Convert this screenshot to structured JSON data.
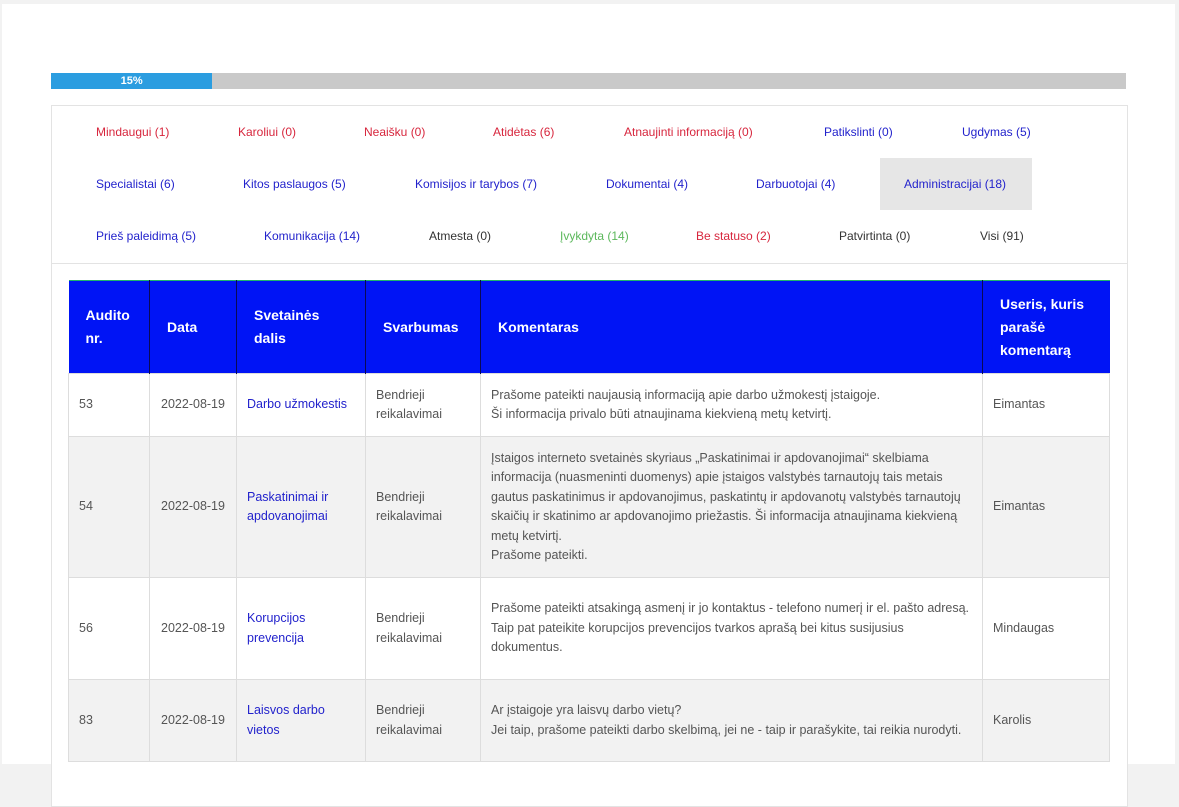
{
  "progress": {
    "label": "15%",
    "value": 0.15
  },
  "filters": [
    {
      "label": "Mindaugui (1)",
      "color": "red"
    },
    {
      "label": "Karoliui (0)",
      "color": "red"
    },
    {
      "label": "Neaišku (0)",
      "color": "red"
    },
    {
      "label": "Atidėtas (6)",
      "color": "red"
    },
    {
      "label": "Atnaujinti informaciją (0)",
      "color": "red"
    },
    {
      "label": "Patikslinti (0)",
      "color": "blue"
    },
    {
      "label": "Ugdymas (5)",
      "color": "blue"
    },
    {
      "label": "Specialistai (6)",
      "color": "blue"
    },
    {
      "label": "Kitos paslaugos (5)",
      "color": "blue"
    },
    {
      "label": "Komisijos ir tarybos (7)",
      "color": "blue"
    },
    {
      "label": "Dokumentai (4)",
      "color": "blue"
    },
    {
      "label": "Darbuotojai (4)",
      "color": "blue"
    },
    {
      "label": "Administracijai (18)",
      "color": "blue",
      "active": true
    },
    {
      "label": "Prieš paleidimą (5)",
      "color": "blue"
    },
    {
      "label": "Komunikacija (14)",
      "color": "blue"
    },
    {
      "label": "Atmesta (0)",
      "color": "dark"
    },
    {
      "label": "Įvykdyta (14)",
      "color": "green"
    },
    {
      "label": "Be statuso (2)",
      "color": "red"
    },
    {
      "label": "Patvirtinta (0)",
      "color": "dark"
    },
    {
      "label": "Visi (91)",
      "color": "dark"
    }
  ],
  "colors": {
    "header_bg": "#0014f5",
    "red": "#d7263d",
    "blue": "#2222cc",
    "green": "#5cb85c",
    "progress": "#2b9de0"
  },
  "table": {
    "headers": [
      "Audito nr.",
      "Data",
      "Svetainės dalis",
      "Svarbumas",
      "Komentaras",
      "Useris, kuris parašė komentarą"
    ],
    "rows": [
      {
        "nr": "53",
        "date": "2022-08-19",
        "section": "Darbo užmokestis",
        "importance": "Bendrieji reikalavimai",
        "comment": [
          "Prašome pateikti naujausią informaciją apie darbo užmokestį įstaigoje.",
          "Ši informacija privalo būti atnaujinama kiekvieną metų ketvirtį."
        ],
        "user": "Eimantas"
      },
      {
        "nr": "54",
        "date": "2022-08-19",
        "section": "Paskatinimai ir apdovanojimai",
        "importance": "Bendrieji reikalavimai",
        "comment": [
          "Įstaigos interneto svetainės skyriaus „Paskatinimai ir apdovanojimai“ skelbiama informacija (nuasmeninti duomenys) apie įstaigos valstybės tarnautojų tais metais gautus paskatinimus ir apdovanojimus, paskatintų ir apdovanotų valstybės tarnautojų skaičių ir skatinimo ar apdovanojimo priežastis. Ši informacija atnaujinama kiekvieną metų ketvirtį.",
          "Prašome pateikti."
        ],
        "user": "Eimantas"
      },
      {
        "nr": "56",
        "date": "2022-08-19",
        "section": "Korupcijos prevencija",
        "importance": "Bendrieji reikalavimai",
        "comment": [
          "Prašome pateikti atsakingą asmenį ir jo kontaktus - telefono numerį ir el. pašto adresą.",
          "Taip pat pateikite korupcijos prevencijos tvarkos aprašą bei kitus susijusius dokumentus."
        ],
        "user": "Mindaugas"
      },
      {
        "nr": "83",
        "date": "2022-08-19",
        "section": "Laisvos darbo vietos",
        "importance": "Bendrieji reikalavimai",
        "comment": [
          "Ar įstaigoje yra laisvų darbo vietų?",
          "Jei taip, prašome pateikti darbo skelbimą, jei ne - taip ir parašykite, tai reikia nurodyti."
        ],
        "user": "Karolis"
      }
    ]
  }
}
